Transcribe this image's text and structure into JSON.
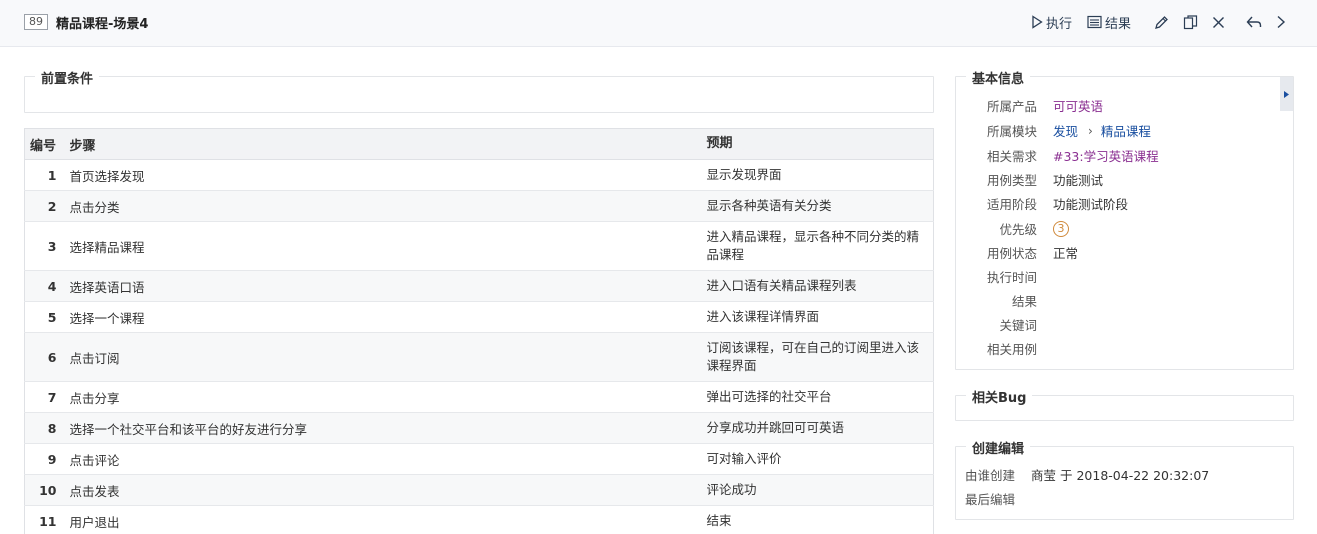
{
  "header": {
    "case_id": "89",
    "title": "精品课程-场景4",
    "run_label": "执行",
    "result_label": "结果"
  },
  "preconditions": {
    "legend": "前置条件"
  },
  "steps_table": {
    "col_num": "编号",
    "col_step": "步骤",
    "col_expect": "预期",
    "rows": [
      {
        "num": "1",
        "step": "首页选择发现",
        "expect": "显示发现界面"
      },
      {
        "num": "2",
        "step": "点击分类",
        "expect": "显示各种英语有关分类"
      },
      {
        "num": "3",
        "step": "选择精品课程",
        "expect": "进入精品课程，显示各种不同分类的精品课程"
      },
      {
        "num": "4",
        "step": "选择英语口语",
        "expect": "进入口语有关精品课程列表"
      },
      {
        "num": "5",
        "step": "选择一个课程",
        "expect": "进入该课程详情界面"
      },
      {
        "num": "6",
        "step": "点击订阅",
        "expect": "订阅该课程，可在自己的订阅里进入该课程界面"
      },
      {
        "num": "7",
        "step": "点击分享",
        "expect": "弹出可选择的社交平台"
      },
      {
        "num": "8",
        "step": "选择一个社交平台和该平台的好友进行分享",
        "expect": "分享成功并跳回可可英语"
      },
      {
        "num": "9",
        "step": "点击评论",
        "expect": "可对输入评价"
      },
      {
        "num": "10",
        "step": "点击发表",
        "expect": "评论成功"
      },
      {
        "num": "11",
        "step": "用户退出",
        "expect": "结束"
      }
    ]
  },
  "basic_info": {
    "legend": "基本信息",
    "product_label": "所属产品",
    "product_value": "可可英语",
    "module_label": "所属模块",
    "module_parent": "发现",
    "module_child": "精品课程",
    "story_label": "相关需求",
    "story_value": "#33:学习英语课程",
    "type_label": "用例类型",
    "type_value": "功能测试",
    "stage_label": "适用阶段",
    "stage_value": "功能测试阶段",
    "priority_label": "优先级",
    "priority_value": "3",
    "status_label": "用例状态",
    "status_value": "正常",
    "exec_time_label": "执行时间",
    "result_label": "结果",
    "keywords_label": "关键词",
    "related_cases_label": "相关用例"
  },
  "related_bug": {
    "legend": "相关Bug"
  },
  "create_edit": {
    "legend": "创建编辑",
    "created_label": "由谁创建",
    "created_value": "商莹 于 2018-04-22 20:32:07",
    "edited_label": "最后编辑"
  }
}
